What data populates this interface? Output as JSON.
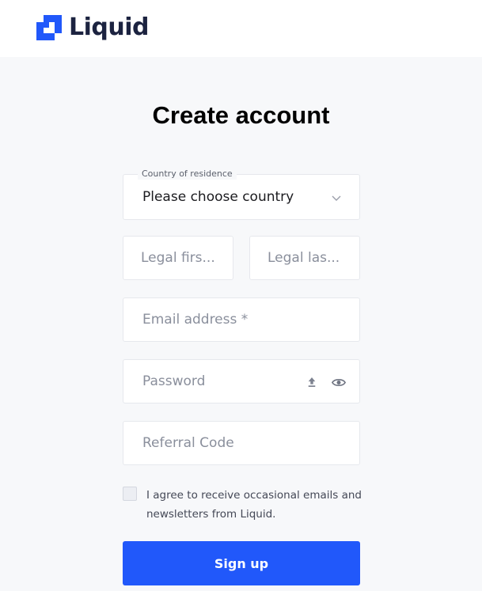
{
  "header": {
    "logo_text": "Liquid",
    "brand_color": "#2158fa"
  },
  "page": {
    "title": "Create account"
  },
  "form": {
    "country": {
      "label": "Country of residence",
      "value": "Please choose country",
      "icon": "chevron-down-icon"
    },
    "first_name": {
      "placeholder": "Legal firs..."
    },
    "last_name": {
      "placeholder": "Legal las..."
    },
    "email": {
      "placeholder": "Email address *"
    },
    "password": {
      "placeholder": "Password",
      "icons": [
        "upload-icon",
        "eye-icon"
      ]
    },
    "referral": {
      "placeholder": "Referral Code"
    },
    "agree": {
      "text": "I agree to receive occasional emails and newsletters from Liquid.",
      "checked": false
    },
    "signup_label": "Sign up"
  }
}
